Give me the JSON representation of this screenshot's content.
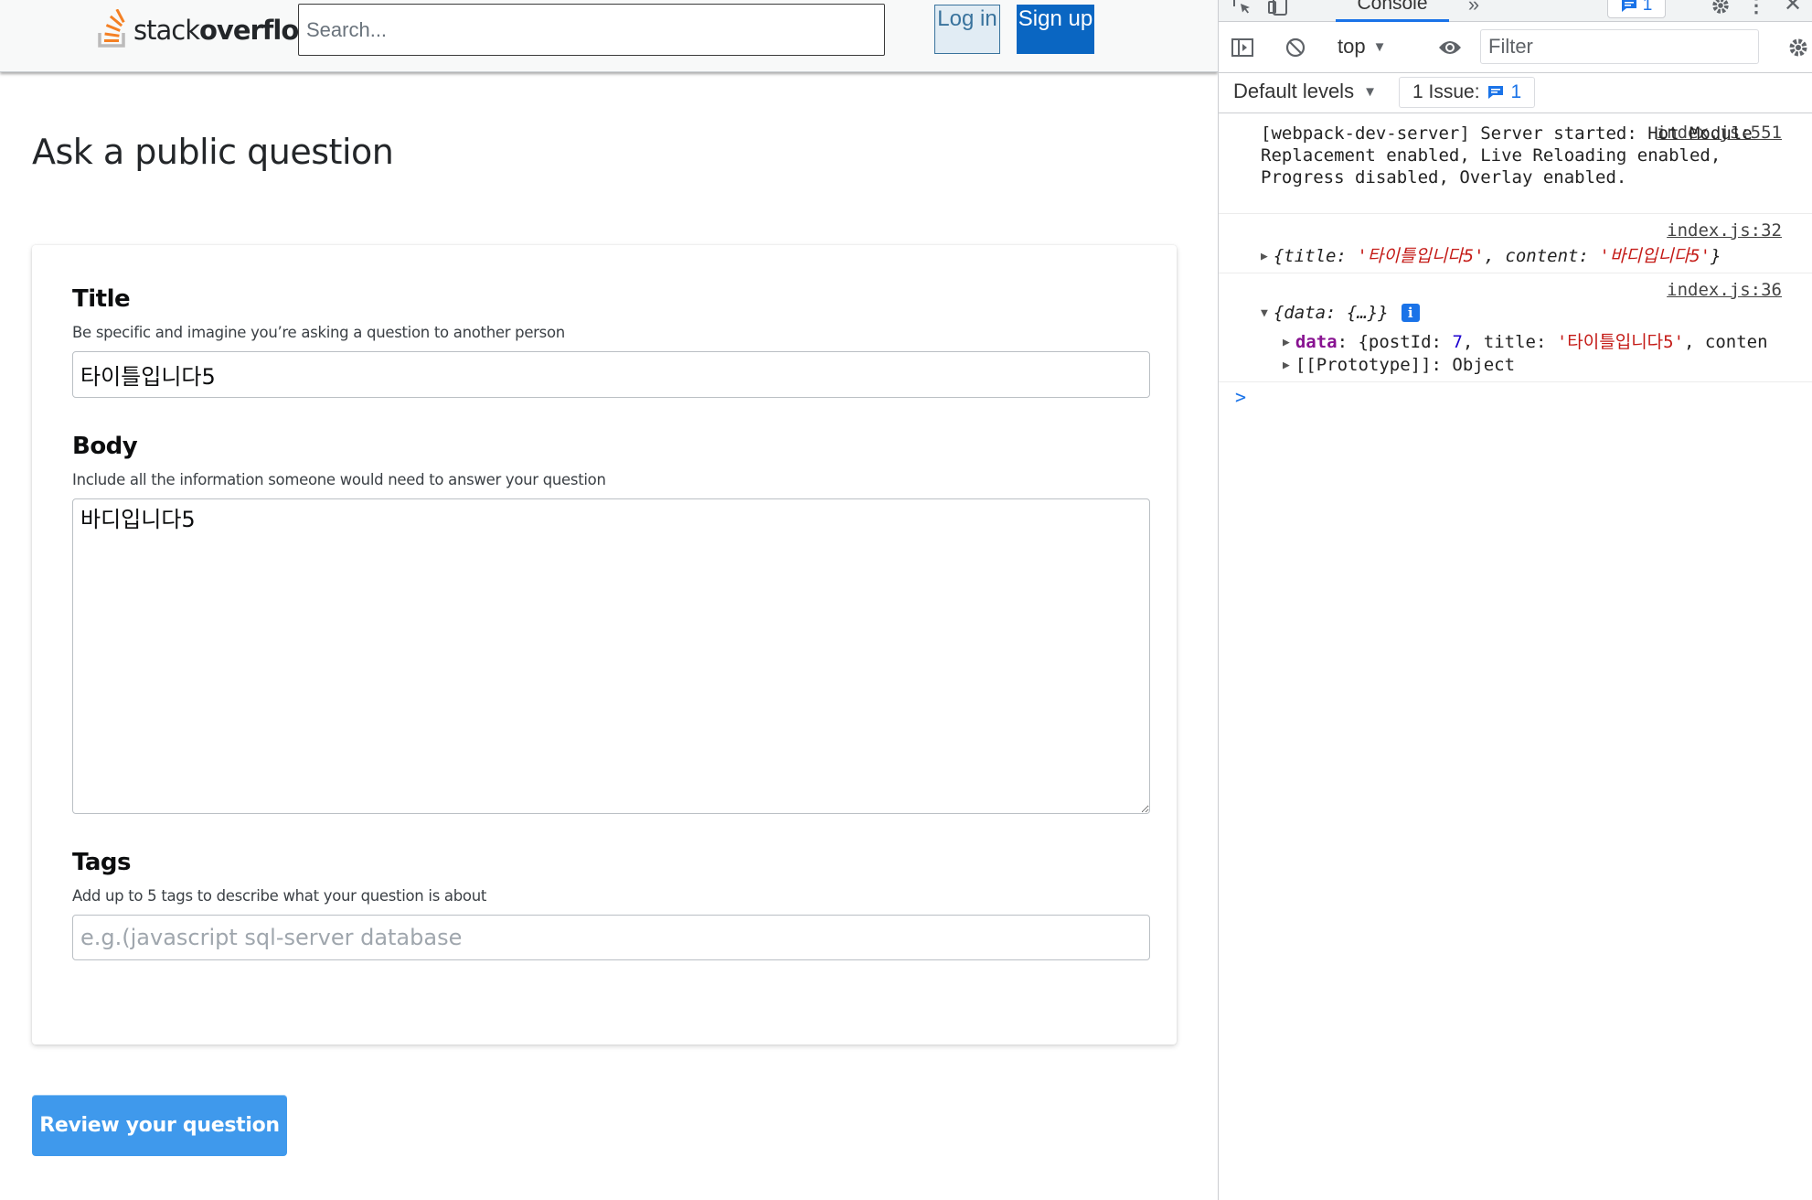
{
  "header": {
    "logo_text_light": "stack",
    "logo_text_bold": "overflow",
    "search_placeholder": "Search...",
    "login_label": "Log in",
    "signup_label": "Sign up"
  },
  "page": {
    "title": "Ask a public question"
  },
  "form": {
    "title_label": "Title",
    "title_desc": "Be specific and imagine you’re asking a question to another person",
    "title_value": "타이틀입니다5",
    "body_label": "Body",
    "body_desc": "Include all the information someone would need to answer your question",
    "body_value": "바디입니다5",
    "tags_label": "Tags",
    "tags_desc": "Add up to 5 tags to describe what your question is about",
    "tags_placeholder": "e.g.(javascript sql-server database",
    "review_label": "Review your question"
  },
  "colors": {
    "accent_blue": "#3f99ec",
    "signup_blue": "#0a66c2",
    "login_bg": "#e1ecf4",
    "logo_orange": "#f48024",
    "devtools_blue": "#1a73e8",
    "string_red": "#c41a16",
    "number_blue": "#1c00cf",
    "key_purple": "#881391"
  },
  "devtools": {
    "active_tab": "Console",
    "issues_badge_count": "1",
    "context": "top",
    "filter_placeholder": "Filter",
    "levels_label": "Default levels",
    "issue_count_label": "1 Issue:",
    "issue_count_num": "1",
    "icons": [
      "inspect-icon",
      "device-icon",
      "more-tabs-icon",
      "message-icon",
      "settings-icon",
      "kebab-icon",
      "close-icon",
      "sidebar-icon",
      "clear-icon",
      "eye-icon"
    ],
    "logs": [
      {
        "source": "index.js:551",
        "message": "[webpack-dev-server] Server started: Hot Module Replacement enabled, Live Reloading enabled, Progress disabled, Overlay enabled."
      },
      {
        "source": "index.js:32",
        "prefix": "{title: ",
        "title_value": "'타이틀입니다5'",
        "middle": ", content: ",
        "content_value": "'바디입니다5'",
        "suffix": "}"
      },
      {
        "source": "index.js:36",
        "summary": "{data: {…}}",
        "info_badge": "i",
        "data_key": "data",
        "data_text_pre": ": {postId: ",
        "data_post_id": "7",
        "data_text_mid": ", title: ",
        "data_title": "'타이틀입니다5'",
        "data_text_post": ", conten",
        "proto_line": "[[Prototype]]: Object"
      }
    ],
    "prompt": ">"
  }
}
